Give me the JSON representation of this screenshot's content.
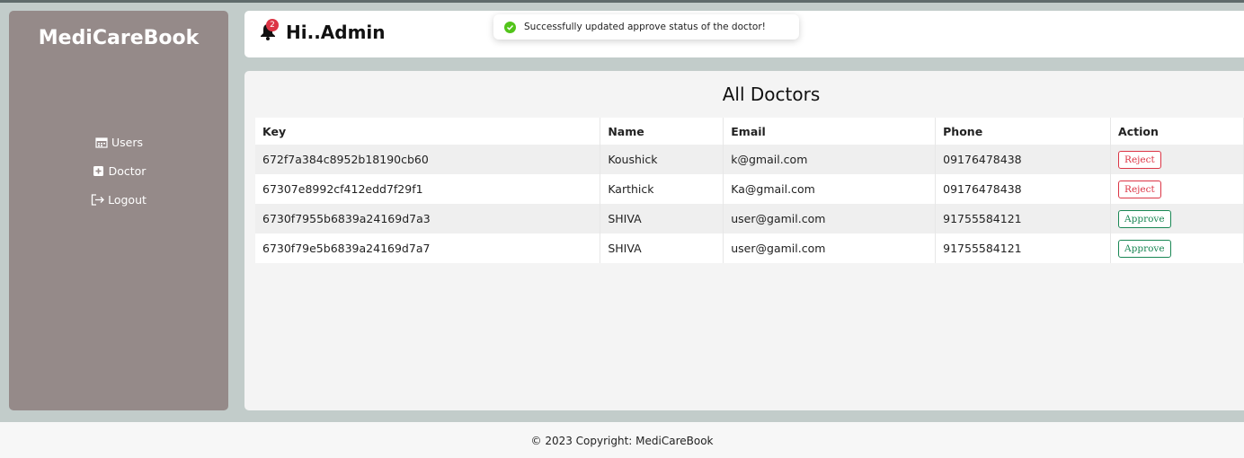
{
  "sidebar": {
    "brand": "MediCareBook",
    "items": [
      {
        "label": "Users",
        "icon": "calendar-icon"
      },
      {
        "label": "Doctor",
        "icon": "doctor-add-icon"
      },
      {
        "label": "Logout",
        "icon": "logout-icon"
      }
    ]
  },
  "header": {
    "notification_count": "2",
    "greeting": "Hi..Admin"
  },
  "toast": {
    "message": "Successfully updated approve status of the doctor!"
  },
  "main": {
    "title": "All Doctors",
    "columns": [
      "Key",
      "Name",
      "Email",
      "Phone",
      "Action"
    ],
    "rows": [
      {
        "key": "672f7a384c8952b18190cb60",
        "name": "Koushick",
        "email": "k@gmail.com",
        "phone": "09176478438",
        "action": "Reject"
      },
      {
        "key": "67307e8992cf412edd7f29f1",
        "name": "Karthick",
        "email": "Ka@gmail.com",
        "phone": "09176478438",
        "action": "Reject"
      },
      {
        "key": "6730f7955b6839a24169d7a3",
        "name": "SHIVA",
        "email": "user@gamil.com",
        "phone": "91755584121",
        "action": "Approve"
      },
      {
        "key": "6730f79e5b6839a24169d7a7",
        "name": "SHIVA",
        "email": "user@gamil.com",
        "phone": "91755584121",
        "action": "Approve"
      }
    ]
  },
  "footer": {
    "text": "© 2023 Copyright: MediCareBook"
  },
  "colors": {
    "sidebar": "#958a89",
    "background": "#c2ccca",
    "reject": "#dc3545",
    "approve": "#198754",
    "toast_success": "#52c41a"
  }
}
